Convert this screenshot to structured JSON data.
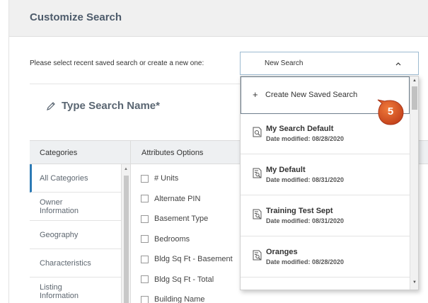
{
  "header": {
    "title": "Customize Search"
  },
  "prompt": {
    "label": "Please select recent saved search or create a new one:"
  },
  "select": {
    "value": "New Search",
    "chevron_icon": "chevron-up-icon"
  },
  "search_name": {
    "placeholder": "Type Search Name*",
    "icon": "pencil-icon"
  },
  "table": {
    "categories_header": "Categories",
    "attributes_header": "Attributes Options"
  },
  "categories": [
    {
      "label": "All Categories",
      "active": true
    },
    {
      "label": "Owner Information"
    },
    {
      "label": "Geography"
    },
    {
      "label": "Characteristics"
    },
    {
      "label": "Listing Information"
    }
  ],
  "attributes": [
    {
      "label": "# Units"
    },
    {
      "label": "Alternate PIN"
    },
    {
      "label": "Basement Type"
    },
    {
      "label": "Bedrooms"
    },
    {
      "label": "Bldg Sq Ft - Basement"
    },
    {
      "label": "Bldg Sq Ft - Total"
    },
    {
      "label": "Building Name"
    }
  ],
  "dropdown": {
    "create_label": "Create New Saved Search",
    "create_icon": "plus-icon",
    "items": [
      {
        "name": "My Search Default",
        "date": "Date modified: 08/28/2020"
      },
      {
        "name": "My Default",
        "date": "Date modified: 08/31/2020"
      },
      {
        "name": "Training Test Sept",
        "date": "Date modified: 08/31/2020"
      },
      {
        "name": "Oranges",
        "date": "Date modified: 08/28/2020"
      }
    ]
  },
  "callout": {
    "number": "5",
    "color": "#d9501e"
  },
  "colors": {
    "accent": "#2c7ab5",
    "header_bg": "#f0f0f0",
    "title_text": "#4d5b6b"
  }
}
